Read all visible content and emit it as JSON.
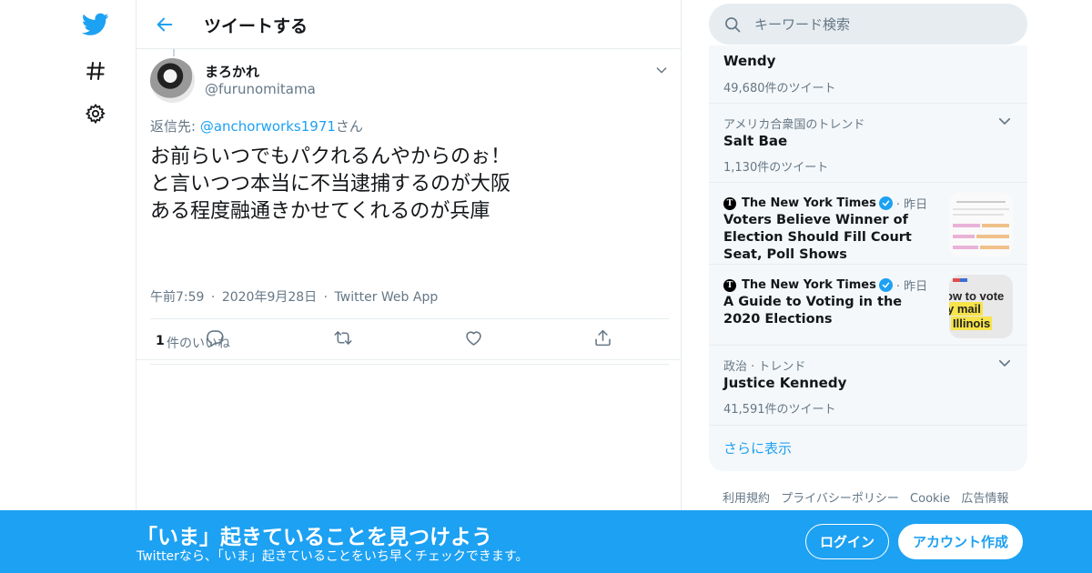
{
  "colors": {
    "accent": "#1da1f2",
    "text": "#14171a",
    "secondary": "#657786",
    "border": "#e6ecf0"
  },
  "nav": {
    "icons": [
      "twitter-bird-icon",
      "hashtag-icon",
      "gear-icon"
    ]
  },
  "header": {
    "title": "ツイートする"
  },
  "tweet": {
    "author_name": "まろかれ",
    "author_handle": "@furunomitama",
    "reply_prefix": "返信先: ",
    "reply_handle": "@anchorworks1971",
    "reply_suffix": "さん",
    "text": "お前らいつでもパクれるんやからのぉ！\nと言いつつ本当に不当逮捕するのが大阪\nある程度融通きかせてくれるのが兵庫",
    "time": "午前7:59",
    "date": "2020年9月28日",
    "source": "Twitter Web App",
    "sep": "·",
    "like_count": "1",
    "like_label": "件のいいね"
  },
  "search": {
    "placeholder": "キーワード検索"
  },
  "trends": [
    {
      "name": "Wendy",
      "count": "49,680件のツイート"
    },
    {
      "context": "アメリカ合衆国のトレンド",
      "name": "Salt Bae",
      "count": "1,130件のツイート"
    },
    {
      "source": "The New York Times",
      "time": "昨日",
      "headline": "Voters Believe Winner of Election Should Fill Court Seat, Poll Shows"
    },
    {
      "source": "The New York Times",
      "time": "昨日",
      "headline": "A Guide to Voting in the 2020 Elections",
      "thumb_line1": "ow to vote",
      "thumb_line2": "y mail",
      "thumb_line3": "Illinois"
    },
    {
      "context": "政治 · トレンド",
      "name": "Justice Kennedy",
      "count": "41,591件のツイート"
    }
  ],
  "show_more": "さらに表示",
  "footer": {
    "links": [
      "利用規約",
      "プライバシーポリシー",
      "Cookie",
      "広告情報"
    ]
  },
  "bottombar": {
    "title": "「いま」起きていることを見つけよう",
    "subtitle": "Twitterなら、「いま」起きていることをいち早くチェックできます。",
    "login": "ログイン",
    "signup": "アカウント作成"
  }
}
